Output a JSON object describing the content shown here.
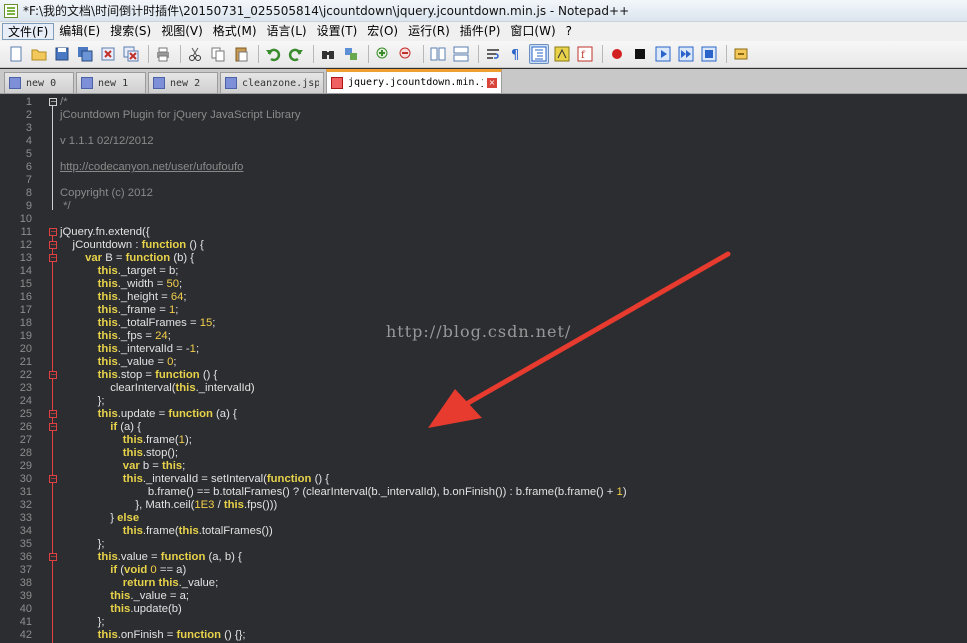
{
  "window": {
    "title": "*F:\\我的文档\\时间倒计时插件\\20150731_025505814\\jcountdown\\jquery.jcountdown.min.js - Notepad++"
  },
  "menu": [
    "文件(F)",
    "编辑(E)",
    "搜索(S)",
    "视图(V)",
    "格式(M)",
    "语言(L)",
    "设置(T)",
    "宏(O)",
    "运行(R)",
    "插件(P)",
    "窗口(W)",
    "?"
  ],
  "toolbar_icons": [
    "new-file-icon",
    "open-file-icon",
    "save-icon",
    "save-all-icon",
    "close-icon",
    "close-all-icon",
    "print-icon",
    "cut-icon",
    "copy-icon",
    "paste-icon",
    "undo-icon",
    "redo-icon",
    "find-icon",
    "replace-icon",
    "zoom-in-icon",
    "zoom-out-icon",
    "sync-v-icon",
    "sync-h-icon",
    "word-wrap-icon",
    "show-all-chars-icon",
    "indent-guide-icon",
    "language-icon",
    "function-list-icon",
    "record-macro-icon",
    "stop-record-icon",
    "play-macro-icon",
    "run-macro-multiple-icon",
    "save-macro-icon",
    "plugin-icon"
  ],
  "tabs": [
    {
      "label": "new 0",
      "active": false,
      "saved": true
    },
    {
      "label": "new 1",
      "active": false,
      "saved": true
    },
    {
      "label": "new 2",
      "active": false,
      "saved": true
    },
    {
      "label": "cleanzone.jsp",
      "active": false,
      "saved": true
    },
    {
      "label": "jquery.jcountdown.min.js",
      "active": true,
      "saved": false
    }
  ],
  "colors": {
    "editor_bg": "#2b2d31",
    "keyword": "#e7d24a",
    "comment": "#8a8a8a",
    "text": "#e2e2e2",
    "fold_marker": "#e04040",
    "active_tab_accent": "#f0a030",
    "arrow": "#e63b2e"
  },
  "watermark": "http://blog.csdn.net/",
  "code_lines": [
    [
      [
        "cm",
        "/*"
      ]
    ],
    [
      [
        "cm",
        "jCountdown Plugin for jQuery JavaScript Library"
      ]
    ],
    [
      [
        "cm",
        ""
      ]
    ],
    [
      [
        "cm",
        "v 1.1.1 02/12/2012"
      ]
    ],
    [
      [
        "cm",
        ""
      ]
    ],
    [
      [
        "cm url",
        "http://codecanyon.net/user/ufoufoufo"
      ]
    ],
    [
      [
        "cm",
        ""
      ]
    ],
    [
      [
        "cm",
        "Copyright (c) 2012"
      ]
    ],
    [
      [
        "cm",
        " */"
      ]
    ],
    [
      [
        "t",
        ""
      ]
    ],
    [
      [
        "t",
        "jQuery.fn.extend({"
      ]
    ],
    [
      [
        "t",
        "    jCountdown : "
      ],
      [
        "kw",
        "function"
      ],
      [
        "t",
        " () {"
      ]
    ],
    [
      [
        "t",
        "        "
      ],
      [
        "kw",
        "var"
      ],
      [
        "t",
        " B = "
      ],
      [
        "kw",
        "function"
      ],
      [
        "t",
        " (b) {"
      ]
    ],
    [
      [
        "t",
        "            "
      ],
      [
        "kw",
        "this"
      ],
      [
        "t",
        "._target = b;"
      ]
    ],
    [
      [
        "t",
        "            "
      ],
      [
        "kw",
        "this"
      ],
      [
        "t",
        "._width = "
      ],
      [
        "nb",
        "50"
      ],
      [
        "t",
        ";"
      ]
    ],
    [
      [
        "t",
        "            "
      ],
      [
        "kw",
        "this"
      ],
      [
        "t",
        "._height = "
      ],
      [
        "nb",
        "64"
      ],
      [
        "t",
        ";"
      ]
    ],
    [
      [
        "t",
        "            "
      ],
      [
        "kw",
        "this"
      ],
      [
        "t",
        "._frame = "
      ],
      [
        "nb",
        "1"
      ],
      [
        "t",
        ";"
      ]
    ],
    [
      [
        "t",
        "            "
      ],
      [
        "kw",
        "this"
      ],
      [
        "t",
        "._totalFrames = "
      ],
      [
        "nb",
        "15"
      ],
      [
        "t",
        ";"
      ]
    ],
    [
      [
        "t",
        "            "
      ],
      [
        "kw",
        "this"
      ],
      [
        "t",
        "._fps = "
      ],
      [
        "nb",
        "24"
      ],
      [
        "t",
        ";"
      ]
    ],
    [
      [
        "t",
        "            "
      ],
      [
        "kw",
        "this"
      ],
      [
        "t",
        "._intervalId = -"
      ],
      [
        "nb",
        "1"
      ],
      [
        "t",
        ";"
      ]
    ],
    [
      [
        "t",
        "            "
      ],
      [
        "kw",
        "this"
      ],
      [
        "t",
        "._value = "
      ],
      [
        "nb",
        "0"
      ],
      [
        "t",
        ";"
      ]
    ],
    [
      [
        "t",
        "            "
      ],
      [
        "kw",
        "this"
      ],
      [
        "t",
        ".stop = "
      ],
      [
        "kw",
        "function"
      ],
      [
        "t",
        " () {"
      ]
    ],
    [
      [
        "t",
        "                clearInterval("
      ],
      [
        "kw",
        "this"
      ],
      [
        "t",
        "._intervalId)"
      ]
    ],
    [
      [
        "t",
        "            };"
      ]
    ],
    [
      [
        "t",
        "            "
      ],
      [
        "kw",
        "this"
      ],
      [
        "t",
        ".update = "
      ],
      [
        "kw",
        "function"
      ],
      [
        "t",
        " (a) {"
      ]
    ],
    [
      [
        "t",
        "                "
      ],
      [
        "kw",
        "if"
      ],
      [
        "t",
        " (a) {"
      ]
    ],
    [
      [
        "t",
        "                    "
      ],
      [
        "kw",
        "this"
      ],
      [
        "t",
        ".frame("
      ],
      [
        "nb",
        "1"
      ],
      [
        "t",
        ");"
      ]
    ],
    [
      [
        "t",
        "                    "
      ],
      [
        "kw",
        "this"
      ],
      [
        "t",
        ".stop();"
      ]
    ],
    [
      [
        "t",
        "                    "
      ],
      [
        "kw",
        "var"
      ],
      [
        "t",
        " b = "
      ],
      [
        "kw",
        "this"
      ],
      [
        "t",
        ";"
      ]
    ],
    [
      [
        "t",
        "                    "
      ],
      [
        "kw",
        "this"
      ],
      [
        "t",
        "._intervalId = setInterval("
      ],
      [
        "kw",
        "function"
      ],
      [
        "t",
        " () {"
      ]
    ],
    [
      [
        "t",
        "                            b.frame() == b.totalFrames() ? (clearInterval(b._intervalId), b.onFinish()) : b.frame(b.frame() + "
      ],
      [
        "nb",
        "1"
      ],
      [
        "t",
        ")"
      ]
    ],
    [
      [
        "t",
        "                        }, Math.ceil("
      ],
      [
        "nb",
        "1E3"
      ],
      [
        "t",
        " / "
      ],
      [
        "kw",
        "this"
      ],
      [
        "t",
        ".fps()))"
      ]
    ],
    [
      [
        "t",
        "                } "
      ],
      [
        "kw",
        "else"
      ]
    ],
    [
      [
        "t",
        "                    "
      ],
      [
        "kw",
        "this"
      ],
      [
        "t",
        ".frame("
      ],
      [
        "kw",
        "this"
      ],
      [
        "t",
        ".totalFrames())"
      ]
    ],
    [
      [
        "t",
        "            };"
      ]
    ],
    [
      [
        "t",
        "            "
      ],
      [
        "kw",
        "this"
      ],
      [
        "t",
        ".value = "
      ],
      [
        "kw",
        "function"
      ],
      [
        "t",
        " (a, b) {"
      ]
    ],
    [
      [
        "t",
        "                "
      ],
      [
        "kw",
        "if"
      ],
      [
        "t",
        " ("
      ],
      [
        "kw",
        "void"
      ],
      [
        "t",
        " "
      ],
      [
        "nb",
        "0"
      ],
      [
        "t",
        " == a)"
      ]
    ],
    [
      [
        "t",
        "                    "
      ],
      [
        "kw",
        "return this"
      ],
      [
        "t",
        "._value;"
      ]
    ],
    [
      [
        "t",
        "                "
      ],
      [
        "kw",
        "this"
      ],
      [
        "t",
        "._value = a;"
      ]
    ],
    [
      [
        "t",
        "                "
      ],
      [
        "kw",
        "this"
      ],
      [
        "t",
        ".update(b)"
      ]
    ],
    [
      [
        "t",
        "            };"
      ]
    ],
    [
      [
        "t",
        "            "
      ],
      [
        "kw",
        "this"
      ],
      [
        "t",
        ".onFinish = "
      ],
      [
        "kw",
        "function"
      ],
      [
        "t",
        " () {};"
      ]
    ]
  ]
}
